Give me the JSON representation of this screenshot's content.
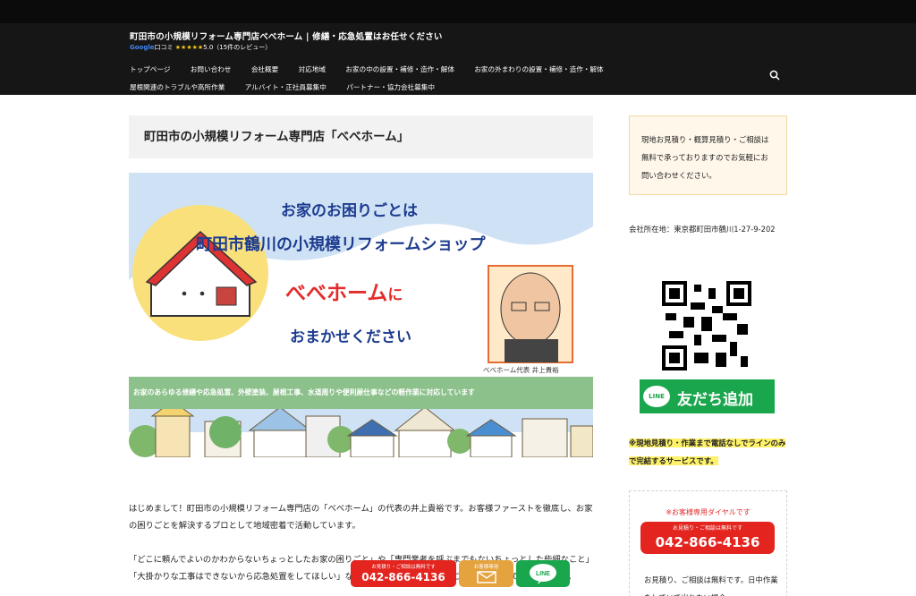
{
  "header": {
    "site_title": "町田市の小規模リフォーム専門店べべホーム | 修繕・応急処置はお任せください",
    "review_google": "Google",
    "review_label": "口コミ",
    "review_stars": "★★★★★",
    "review_score": "5.0（15件のレビュー）",
    "nav": [
      "トップページ",
      "お問い合わせ",
      "会社概要",
      "対応地域",
      "お家の中の設置・補修・造作・解体",
      "お家の外まわりの設置・補修・造作・解体",
      "屋根関連のトラブルや高所作業",
      "アルバイト・正社員募集中",
      "パートナー・協力会社募集中"
    ]
  },
  "main": {
    "page_title": "町田市の小規模リフォーム専門店「べべホーム」",
    "hero": {
      "line1": "お家のお困りごとは",
      "line2": "町田市鶴川の小規模リフォームショップ",
      "line3": "べべホーム",
      "line3_suffix": "に",
      "line4": "おまかせください",
      "caption": "べべホーム代表 井上貴裕",
      "band": "お家のあらゆる修繕や応急処置、外壁塗装、屋根工事、水道周りや便利屋仕事などの軽作業に対応しています"
    },
    "para1": "はじめまして！町田市の小規模リフォーム専門店の「べべホーム」の代表の井上貴裕です。お客様ファーストを徹底し、お家の困りごとを解決するプロとして地域密着で活動しています。",
    "para2": "「どこに頼んでよいのかわからないちょっとしたお家の困りごと」や「専門業者を呼ぶまでもないちょっとした些細なこと」「大掛かりな工事はできないから応急処置をしてほしい」などのご相談にも、お気軽にご依頼いただいていただきます。"
  },
  "sidebar": {
    "box1_text": "現地お見積り・概算見積り・ご相談は無料で承っておりますのでお気軽にお問い合わせください。",
    "address": "会社所在地：東京都町田市鶴川1-27-9-202",
    "line_icon_text": "LINE",
    "line_button_text": "友だち追加",
    "note": "※現地見積り・作業まで電話なしでラインのみで完結するサービスです。",
    "dial_caption": "※お客様専用ダイヤルです",
    "tel_small": "お見積り・ご相談は無料です",
    "tel_number": "042-866-4136",
    "box2_desc": "お見積り、ご相談は無料です。日中作業をしていて出れない場合"
  },
  "fixed_bar": {
    "tel_small": "お見積り・ご相談は無料です",
    "tel_number": "042-866-4136",
    "mail_label": "お客様専用",
    "line_label": "LINE"
  }
}
